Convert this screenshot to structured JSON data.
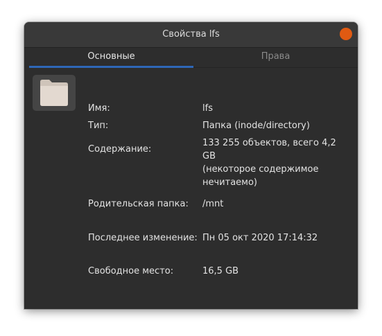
{
  "window": {
    "title": "Свойства lfs"
  },
  "tabs": [
    {
      "label": "Основные",
      "active": true
    },
    {
      "label": "Права",
      "active": false
    }
  ],
  "icon": {
    "name": "folder-icon",
    "color": "#e3d9d0"
  },
  "properties": {
    "name": {
      "label": "Имя:",
      "value": "lfs"
    },
    "type": {
      "label": "Тип:",
      "value": "Папка (inode/directory)"
    },
    "contents": {
      "label": "Содержание:",
      "value_lines": [
        "133 255 объектов, всего 4,2 GB",
        "(некоторое содержимое",
        "нечитаемо)"
      ]
    },
    "parent": {
      "label": "Родительская папка:",
      "value": "/mnt"
    },
    "modified": {
      "label": "Последнее изменение:",
      "value": "Пн 05 окт 2020 17:14:32"
    },
    "free_space": {
      "label": "Свободное место:",
      "value": "16,5 GB"
    }
  },
  "colors": {
    "accent": "#2e67b8",
    "close_button": "#e05a12",
    "window_bg": "#2d2d2d"
  }
}
